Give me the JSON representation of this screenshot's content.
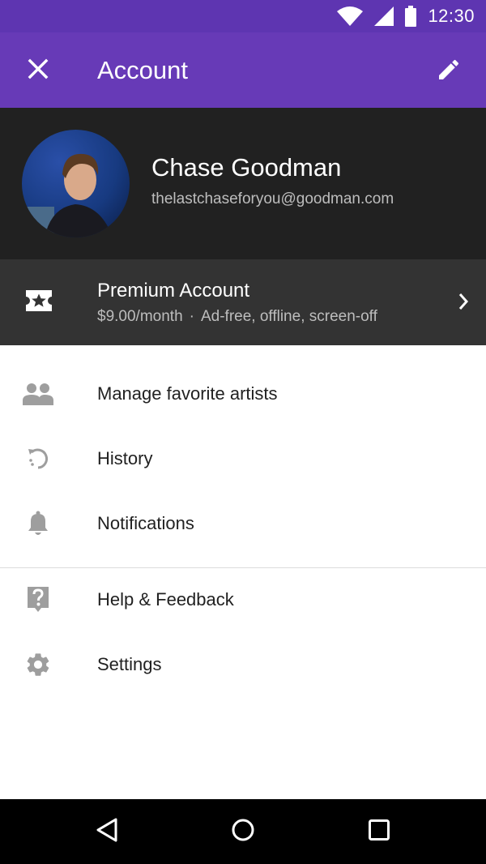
{
  "status_bar": {
    "time": "12:30",
    "icons": [
      "wifi-icon",
      "cell-signal-icon",
      "battery-icon"
    ]
  },
  "app_bar": {
    "title": "Account",
    "left_icon": "close-icon",
    "right_icon": "edit-pencil-icon",
    "color": "#673ab7"
  },
  "profile": {
    "name": "Chase Goodman",
    "email": "thelastchaseforyou@goodman.com"
  },
  "premium": {
    "title": "Premium Account",
    "price": "$9.00/month",
    "separator": "·",
    "features": "Ad-free, offline, screen-off",
    "icon": "ticket-star-icon"
  },
  "menu": {
    "items": [
      {
        "label": "Manage favorite artists",
        "icon": "people-icon"
      },
      {
        "label": "History",
        "icon": "history-icon"
      },
      {
        "label": "Notifications",
        "icon": "bell-icon"
      },
      {
        "label": "Help & Feedback",
        "icon": "help-icon"
      },
      {
        "label": "Settings",
        "icon": "gear-icon"
      }
    ]
  },
  "nav_bar": {
    "buttons": [
      "back-triangle-icon",
      "home-circle-icon",
      "recents-square-icon"
    ]
  }
}
